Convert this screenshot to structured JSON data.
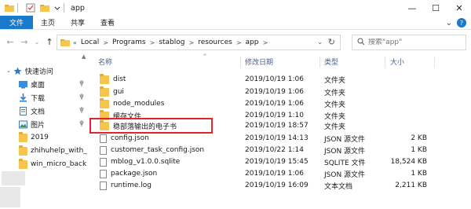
{
  "window": {
    "title": "app",
    "minimize": "—",
    "maximize": "☐",
    "close": "✕"
  },
  "ribbon": {
    "tabs": [
      "文件",
      "主页",
      "共享",
      "查看"
    ],
    "collapse": "⌄",
    "help": "?"
  },
  "address": {
    "back": "←",
    "forward": "→",
    "recent": "⌄",
    "up": "↑",
    "overflow": "«",
    "crumbs": [
      "Local",
      "Programs",
      "stablog",
      "resources",
      "app"
    ],
    "separator": ">",
    "dropdown": "⌄",
    "refresh": "↻"
  },
  "search": {
    "placeholder": "搜索\"app\""
  },
  "nav": {
    "quick_access": "快速访问",
    "items": [
      {
        "label": "桌面",
        "pinned": true
      },
      {
        "label": "下载",
        "pinned": true
      },
      {
        "label": "文档",
        "pinned": true
      },
      {
        "label": "图片",
        "pinned": true
      },
      {
        "label": "2019",
        "pinned": false
      },
      {
        "label": "zhihuhelp_with_",
        "pinned": false
      },
      {
        "label": "win_micro_back",
        "pinned": false
      }
    ],
    "pin_glyph": "📌"
  },
  "columns": {
    "name": "名称",
    "date": "修改日期",
    "type": "类型",
    "size": "大小",
    "sort_caret": "^"
  },
  "files": [
    {
      "name": "dist",
      "date": "2019/10/19 1:06",
      "type": "文件夹",
      "size": "",
      "kind": "folder"
    },
    {
      "name": "gui",
      "date": "2019/10/19 1:06",
      "type": "文件夹",
      "size": "",
      "kind": "folder"
    },
    {
      "name": "node_modules",
      "date": "2019/10/19 1:06",
      "type": "文件夹",
      "size": "",
      "kind": "folder"
    },
    {
      "name": "缓存文件",
      "date": "2019/10/19 1:10",
      "type": "文件夹",
      "size": "",
      "kind": "folder"
    },
    {
      "name": "稳部落输出的电子书",
      "date": "2019/10/19 18:57",
      "type": "文件夹",
      "size": "",
      "kind": "folder"
    },
    {
      "name": "config.json",
      "date": "2019/10/19 14:13",
      "type": "JSON 源文件",
      "size": "2 KB",
      "kind": "file"
    },
    {
      "name": "customer_task_config.json",
      "date": "2019/10/22 1:14",
      "type": "JSON 源文件",
      "size": "1 KB",
      "kind": "file"
    },
    {
      "name": "mblog_v1.0.0.sqlite",
      "date": "2019/10/19 15:45",
      "type": "SQLITE 文件",
      "size": "18,524 KB",
      "kind": "file"
    },
    {
      "name": "package.json",
      "date": "2019/10/19 1:06",
      "type": "JSON 源文件",
      "size": "1 KB",
      "kind": "file"
    },
    {
      "name": "runtime.log",
      "date": "2019/10/19 16:09",
      "type": "文本文档",
      "size": "2,211 KB",
      "kind": "file"
    }
  ],
  "colors": {
    "file_tab": "#1979ca",
    "folder": "#f5c54e",
    "highlight": "#e0262a",
    "header_text": "#4d6185"
  }
}
